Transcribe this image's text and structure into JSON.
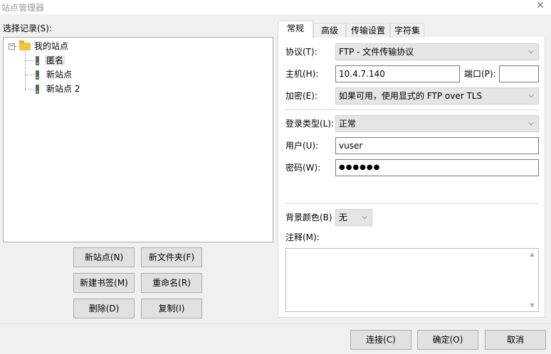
{
  "window": {
    "title": "站点管理器",
    "close_glyph": "✕"
  },
  "left": {
    "label": "选择记录(S):",
    "tree": {
      "root": "我的站点",
      "expander": "−",
      "items": [
        "匿名",
        "新站点",
        "新站点 2"
      ]
    },
    "buttons": {
      "new_site": "新站点(N)",
      "new_folder": "新文件夹(F)",
      "new_bookmark": "新建书签(M)",
      "rename": "重命名(R)",
      "delete": "删除(D)",
      "copy": "复制(I)"
    }
  },
  "tabs": [
    "常规",
    "高级",
    "传输设置",
    "字符集"
  ],
  "general": {
    "protocol_label": "协议(T):",
    "protocol_value": "FTP - 文件传输协议",
    "host_label": "主机(H):",
    "host_value": "10.4.7.140",
    "port_label": "端口(P):",
    "port_value": "",
    "encryption_label": "加密(E):",
    "encryption_value": "如果可用，使用显式的 FTP over TLS",
    "logon_type_label": "登录类型(L):",
    "logon_type_value": "正常",
    "user_label": "用户(U):",
    "user_value": "vuser",
    "password_label": "密码(W):",
    "password_value": "●●●●●●",
    "bg_color_label": "背景颜色(B)",
    "bg_color_value": "无",
    "comments_label": "注释(M):",
    "comments_value": ""
  },
  "dialog_buttons": {
    "connect": "连接(C)",
    "ok": "确定(O)",
    "cancel": "取消"
  },
  "icons": {
    "dropdown": "chevron-down-icon",
    "folder": "folder-icon",
    "server": "server-icon"
  }
}
